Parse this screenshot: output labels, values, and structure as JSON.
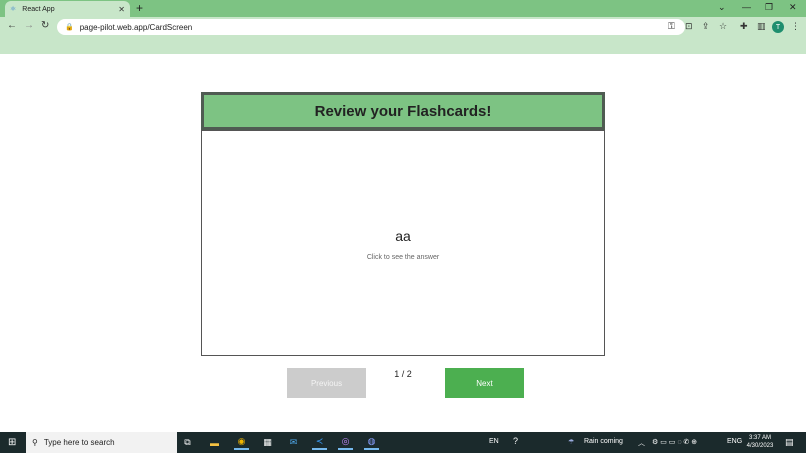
{
  "browser": {
    "tab_title": "React App",
    "tab_close": "✕",
    "new_tab": "+",
    "url": "page-pilot.web.app/CardScreen",
    "profile_initial": "T"
  },
  "page": {
    "heading": "Review your Flashcards!",
    "card_question": "aa",
    "card_hint": "Click to see the answer",
    "counter": "1 / 2",
    "prev_label": "Previous",
    "next_label": "Next"
  },
  "taskbar": {
    "search_placeholder": "Type here to search",
    "lang": "EN",
    "weather": "Rain coming",
    "input_lang": "ENG",
    "time": "3:37 AM",
    "date": "4/30/2023"
  },
  "colors": {
    "accent_green": "#7dc383",
    "next_button": "#4caf50",
    "prev_button_disabled": "#cccccc"
  }
}
